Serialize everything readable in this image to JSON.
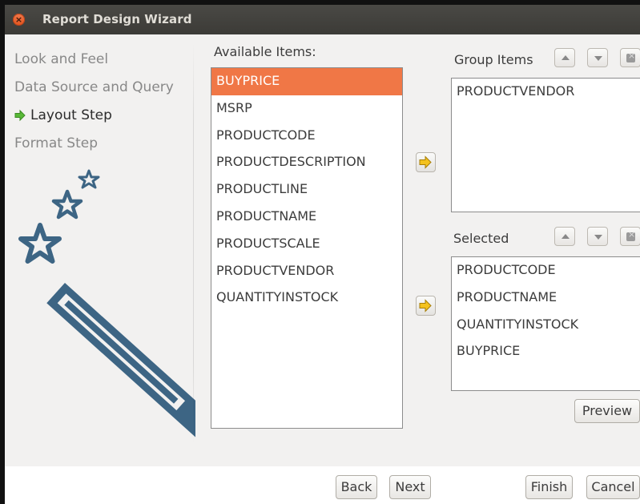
{
  "window": {
    "title": "Report Design Wizard",
    "close_icon": "close-icon"
  },
  "steps": [
    {
      "label": "Look and Feel",
      "state": "done"
    },
    {
      "label": "Data Source and Query",
      "state": "done"
    },
    {
      "label": "Layout Step",
      "state": "current"
    },
    {
      "label": "Format Step",
      "state": "pending"
    }
  ],
  "available": {
    "label": "Available Items:",
    "items": [
      "BUYPRICE",
      "MSRP",
      "PRODUCTCODE",
      "PRODUCTDESCRIPTION",
      "PRODUCTLINE",
      "PRODUCTNAME",
      "PRODUCTSCALE",
      "PRODUCTVENDOR",
      "QUANTITYINSTOCK"
    ],
    "selected_index": 0
  },
  "group_items": {
    "label": "Group Items",
    "items": [
      "PRODUCTVENDOR"
    ]
  },
  "selected": {
    "label": "Selected",
    "items": [
      "PRODUCTCODE",
      "PRODUCTNAME",
      "QUANTITYINSTOCK",
      "BUYPRICE"
    ]
  },
  "buttons": {
    "preview": "Preview",
    "back": "Back",
    "next": "Next",
    "finish": "Finish",
    "cancel": "Cancel"
  },
  "colors": {
    "selection": "#f07746",
    "wand": "#3d6584",
    "titlebar": "#3c3b37",
    "step_arrow": "#58b936"
  }
}
